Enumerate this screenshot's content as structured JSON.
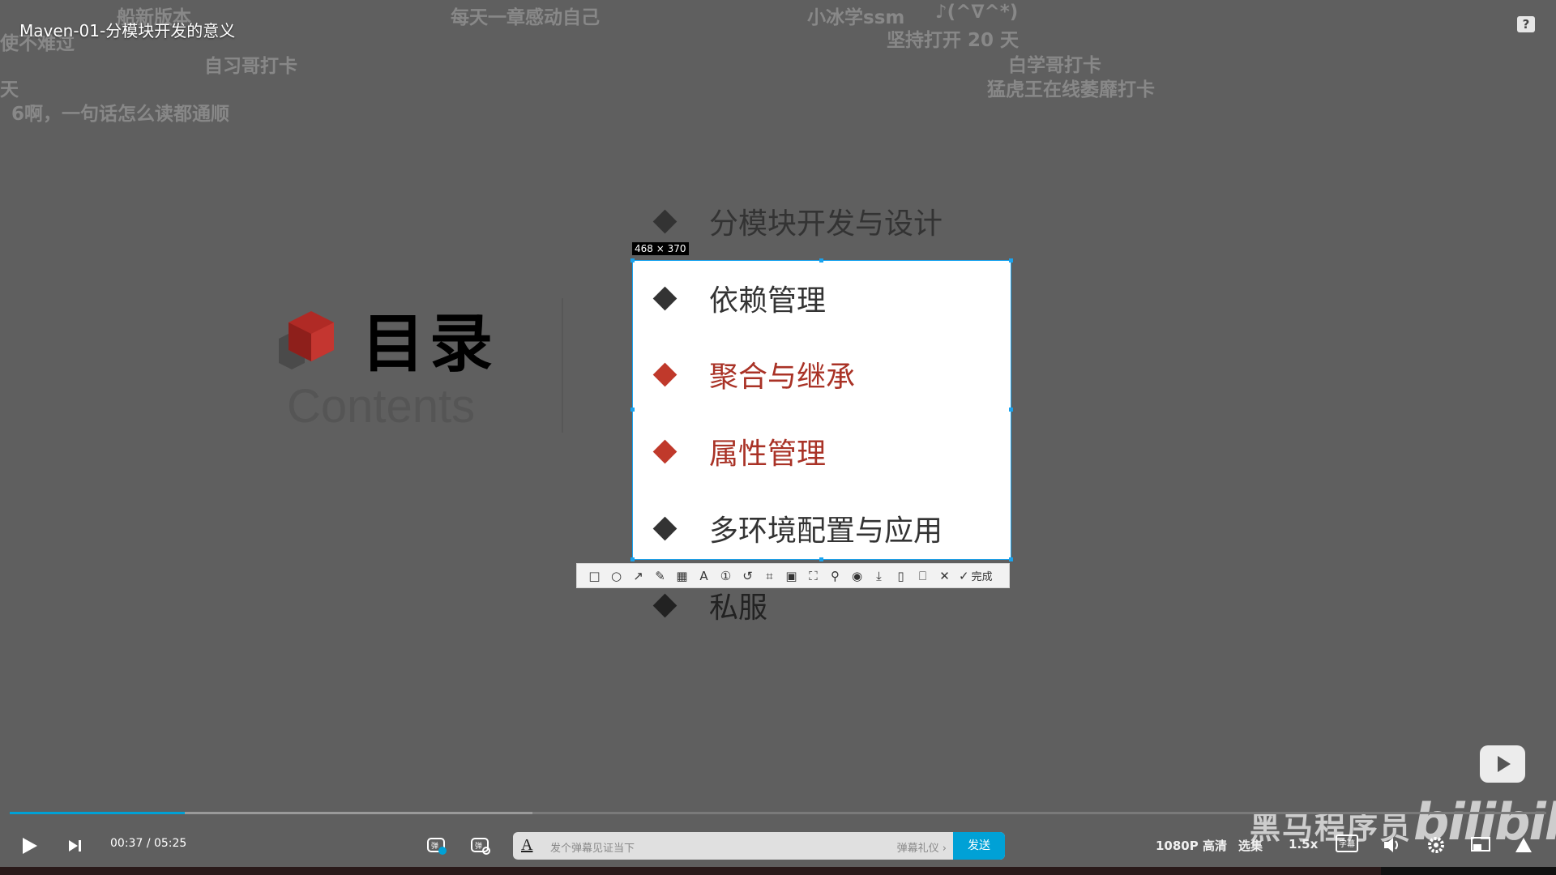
{
  "video": {
    "title": "Maven-01-分模块开发的意义"
  },
  "danmaku": [
    "船新版本",
    "每天一章感动自己",
    "小冰学ssm",
    "♪(^∇^*)",
    "坚持打开 20 天",
    "使不难过",
    "自习哥打卡",
    "白学哥打卡",
    "猛虎王在线萎靡打卡",
    "天",
    "6啊，一句话怎么读都通顺"
  ],
  "slide": {
    "directory_title": "目录",
    "directory_subtitle": "Contents",
    "items": [
      {
        "label": "分模块开发与设计",
        "highlighted": false
      },
      {
        "label": "依赖管理",
        "highlighted": false
      },
      {
        "label": "聚合与继承",
        "highlighted": true
      },
      {
        "label": "属性管理",
        "highlighted": true
      },
      {
        "label": "多环境配置与应用",
        "highlighted": false
      },
      {
        "label": "私服",
        "highlighted": false
      }
    ],
    "colors": {
      "normal": "#333333",
      "highlight": "#c0392b",
      "cube": "#b02a25"
    }
  },
  "screenshot": {
    "size_label": "468 × 370",
    "tools": [
      "rectangle-icon",
      "ellipse-icon",
      "arrow-icon",
      "pencil-icon",
      "mosaic-icon",
      "text-icon",
      "number-icon",
      "undo-icon",
      "crop-icon",
      "ocr-icon",
      "scroll-capture-icon",
      "pin-icon",
      "record-icon",
      "download-icon",
      "copy-icon",
      "bookmark-icon",
      "close-icon"
    ],
    "done_label": "完成"
  },
  "watermark": {
    "brand": "黑马程序员",
    "logo": "bilibili"
  },
  "player": {
    "current_time": "00:37",
    "separator": "/",
    "duration": "05:25",
    "progress": 0.114,
    "buffered": 0.34,
    "danmaku_placeholder": "发个弹幕见证当下",
    "danmaku_etiquette": "弹幕礼仪 ›",
    "send_label": "发送",
    "quality": "1080P 高清",
    "episodes": "选集",
    "speed": "1.5x",
    "subtitle_icon": "字幕",
    "accent": "#00a1d6"
  }
}
